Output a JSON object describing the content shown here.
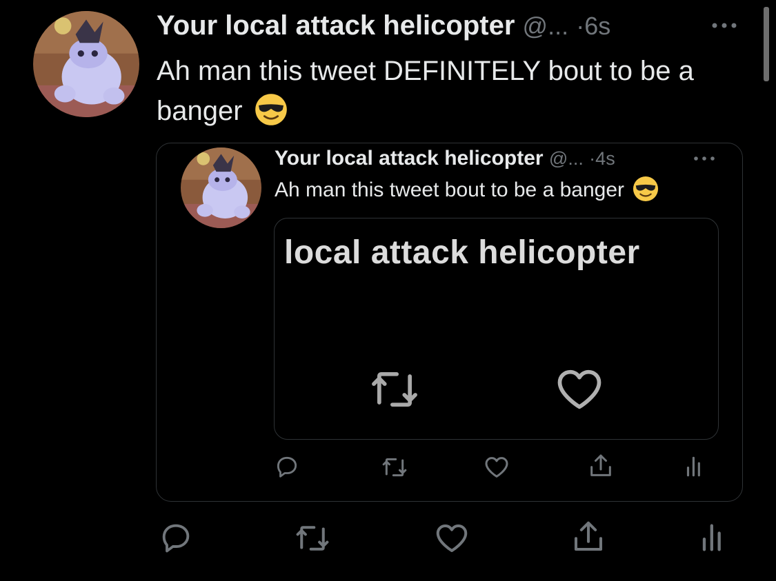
{
  "tweet": {
    "display_name": "Your local attack helicopter",
    "handle": "@...",
    "separator": "·",
    "time": "6s",
    "text": "Ah man this tweet DEFINITELY bout to be a banger",
    "emoji_icon": "smiling-face-with-sunglasses-icon",
    "more_icon": "more-dots-icon"
  },
  "quote": {
    "display_name": "Your local attack helicopter",
    "handle": "@...",
    "separator": "·",
    "time": "4s",
    "text": "Ah man this tweet bout to be a banger",
    "emoji_icon": "smiling-face-with-sunglasses-icon",
    "media": {
      "text": "local attack helicopter",
      "icons": [
        "retweet-icon",
        "heart-icon"
      ]
    },
    "actions": [
      "reply-icon",
      "retweet-icon",
      "like-icon",
      "share-icon",
      "analytics-icon"
    ]
  },
  "actions": [
    "reply-icon",
    "retweet-icon",
    "like-icon",
    "share-icon",
    "analytics-icon"
  ],
  "colors": {
    "background": "#000000",
    "text": "#e7e9ea",
    "muted": "#71767b",
    "border": "#2f3336",
    "emoji": "#f7c948"
  }
}
